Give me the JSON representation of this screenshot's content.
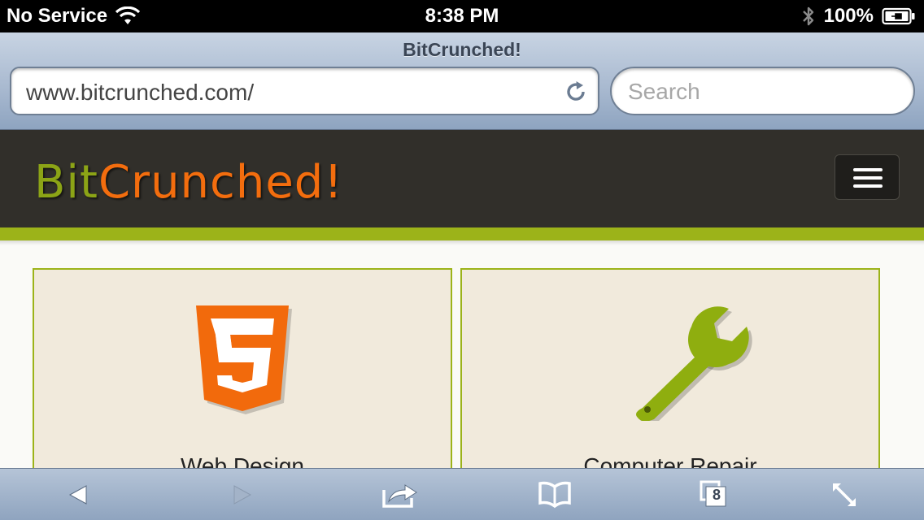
{
  "status_bar": {
    "carrier": "No Service",
    "time": "8:38 PM",
    "battery": "100%"
  },
  "browser": {
    "page_title": "BitCrunched!",
    "url": "www.bitcrunched.com/",
    "search_placeholder": "Search",
    "tab_count": "8"
  },
  "site": {
    "logo_part1": "Bit",
    "logo_part2": "Crunched!",
    "colors": {
      "header_bg": "#312f2a",
      "accent_green": "#9cb319",
      "accent_orange": "#f36d0e",
      "card_bg": "#f1eadc"
    },
    "cards": [
      {
        "label": "Web Design",
        "icon": "html5-icon"
      },
      {
        "label": "Computer Repair",
        "icon": "wrench-icon"
      }
    ]
  },
  "toolbar": {
    "items": [
      "back-icon",
      "forward-icon",
      "share-icon",
      "bookmarks-icon",
      "tabs-icon",
      "fullscreen-icon"
    ]
  }
}
